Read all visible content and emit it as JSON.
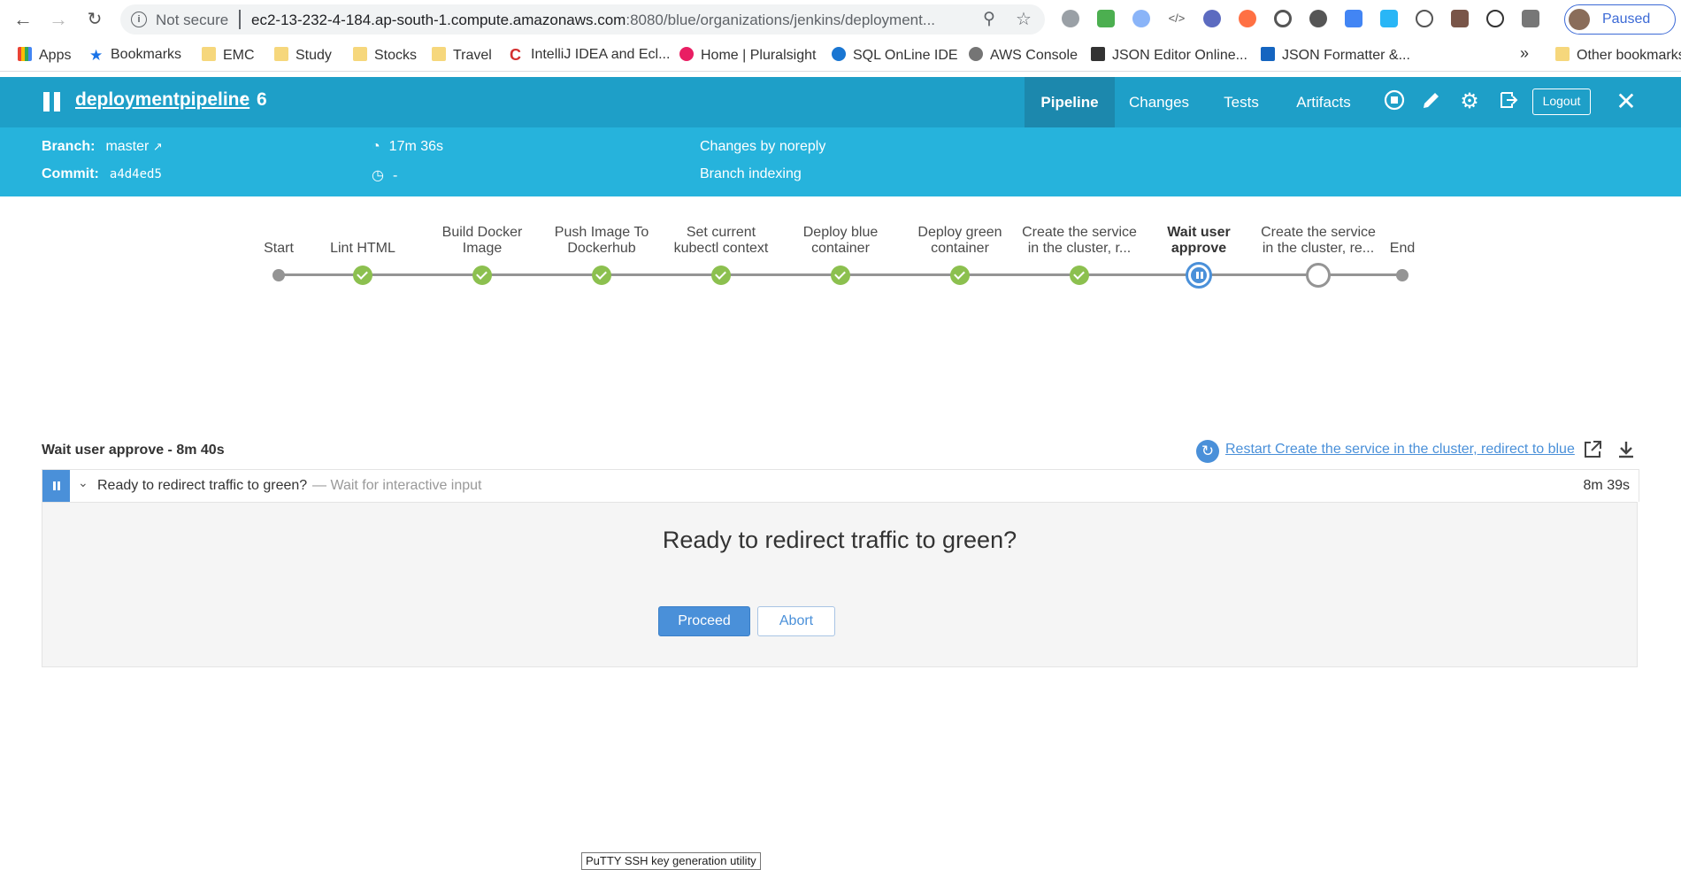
{
  "browser": {
    "security_label": "Not secure",
    "url_host": "ec2-13-232-4-184.ap-south-1.compute.amazonaws.com",
    "url_rest": ":8080/blue/organizations/jenkins/deployment...",
    "profile_label": "Paused"
  },
  "bookmarks": {
    "items": [
      "Apps",
      "Bookmarks",
      "EMC",
      "Study",
      "Stocks",
      "Travel",
      "IntelliJ IDEA and Ecl...",
      "Home | Pluralsight",
      "SQL OnLine IDE",
      "AWS Console",
      "JSON Editor Online...",
      "JSON Formatter &..."
    ],
    "overflow": "»",
    "other": "Other bookmarks"
  },
  "header": {
    "pipeline_name": "deploymentpipeline",
    "run_number": "6",
    "tabs": [
      "Pipeline",
      "Changes",
      "Tests",
      "Artifacts"
    ],
    "logout": "Logout"
  },
  "summary": {
    "branch_label": "Branch:",
    "branch_value": "master",
    "commit_label": "Commit:",
    "commit_value": "a4d4ed5",
    "duration": "17m 36s",
    "ended": "-",
    "changes": "Changes by noreply",
    "cause": "Branch indexing"
  },
  "stages": [
    {
      "label": "Start",
      "status": "start"
    },
    {
      "label": "Lint HTML",
      "status": "success"
    },
    {
      "label": "Build Docker Image",
      "status": "success"
    },
    {
      "label": "Push Image To Dockerhub",
      "status": "success"
    },
    {
      "label": "Set current kubectl context",
      "status": "success"
    },
    {
      "label": "Deploy blue container",
      "status": "success"
    },
    {
      "label": "Deploy green container",
      "status": "success"
    },
    {
      "label": "Create the service in the cluster, r...",
      "status": "success"
    },
    {
      "label": "Wait user approve",
      "status": "paused"
    },
    {
      "label": "Create the service in the cluster, re...",
      "status": "not-built"
    },
    {
      "label": "End",
      "status": "end"
    }
  ],
  "log": {
    "title": "Wait user approve - 8m 40s",
    "restart_link": "Restart Create the service in the cluster, redirect to blue",
    "step_name": "Ready to redirect traffic to green?",
    "step_desc": "— Wait for interactive input",
    "step_duration": "8m 39s"
  },
  "input": {
    "message": "Ready to redirect traffic to green?",
    "proceed": "Proceed",
    "abort": "Abort"
  },
  "tooltip": "PuTTY SSH key generation utility",
  "colors": {
    "header": "#1e9fc8",
    "subheader": "#26b3dc",
    "success": "#8cc04f",
    "running": "#4a90d9",
    "pending": "#949494"
  }
}
